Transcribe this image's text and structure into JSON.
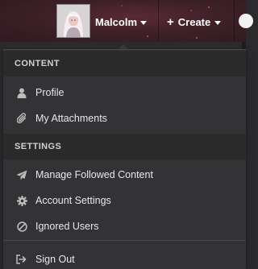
{
  "header": {
    "user_name": "Malcolm",
    "create_label": "Create"
  },
  "menu": {
    "sections": [
      {
        "title": "CONTENT",
        "items": [
          {
            "label": "Profile",
            "icon": "user-icon"
          },
          {
            "label": "My Attachments",
            "icon": "paperclip-icon"
          }
        ]
      },
      {
        "title": "SETTINGS",
        "items": [
          {
            "label": "Manage Followed Content",
            "icon": "paper-plane-icon"
          },
          {
            "label": "Account Settings",
            "icon": "gear-icon"
          },
          {
            "label": "Ignored Users",
            "icon": "ban-icon"
          }
        ]
      }
    ],
    "sign_out": {
      "label": "Sign Out",
      "icon": "sign-out-icon"
    }
  },
  "colors": {
    "header_bg": "#3e2028",
    "dropdown_bg": "#333335",
    "section_bg": "#2a2a2b",
    "icon_color": "#bdbdbd"
  }
}
